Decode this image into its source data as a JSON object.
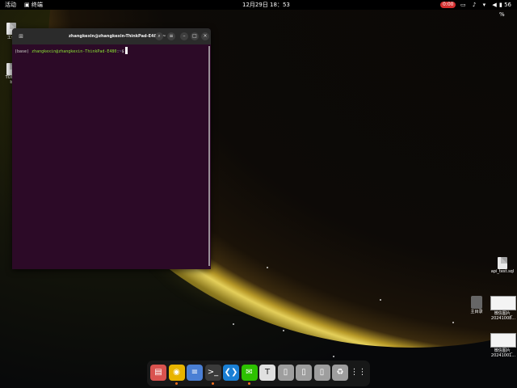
{
  "topbar": {
    "activities": "活动",
    "app_menu": "终端",
    "clock": "12月29日  18：53",
    "recording": "0:00",
    "tray_icons": [
      "display-icon",
      "sound-icon",
      "network-icon",
      "volume-icon"
    ],
    "battery": "56 %"
  },
  "desktop": {
    "left_icons": [
      {
        "name": "workspace-folder",
        "label": "工作"
      },
      {
        "name": "todo-file",
        "label": "TODO"
      },
      {
        "name": "todo-file-sub",
        "label": "b"
      }
    ],
    "right_icons": [
      {
        "name": "api-test-sql",
        "label": "api_test.sql"
      },
      {
        "name": "home-dir",
        "label": "主目录"
      },
      {
        "name": "wechat-image-1",
        "label": "微信图片_",
        "sublabel": "20241008..."
      },
      {
        "name": "wechat-image-2",
        "label": "微信图片_",
        "sublabel": "20241001..."
      }
    ]
  },
  "terminal": {
    "title": "zhangkexin@zhangkexin-ThinkPad-E480: ~",
    "prompt_env": "(base)",
    "prompt_user": "zhangkexin@zhangkexin-ThinkPad-E480",
    "prompt_path": "~",
    "prompt_symbol": "$"
  },
  "dock": {
    "items": [
      {
        "name": "files-app",
        "glyph": "▤",
        "color": "#d9534f",
        "active": false
      },
      {
        "name": "chrome-app",
        "glyph": "◉",
        "color": "#e8b400",
        "active": true
      },
      {
        "name": "text-editor-app",
        "glyph": "≡",
        "color": "#4a7fd4",
        "active": false
      },
      {
        "name": "terminal-app",
        "glyph": ">_",
        "color": "#3a3a3a",
        "active": true
      },
      {
        "name": "vscode-app",
        "glyph": "❮❯",
        "color": "#1a7fd4",
        "active": false
      },
      {
        "name": "wechat-app",
        "glyph": "✉",
        "color": "#2dc100",
        "active": true
      },
      {
        "name": "typora-app",
        "glyph": "T",
        "color": "#e0e0e0",
        "active": false
      },
      {
        "name": "drive-app-1",
        "glyph": "▯",
        "color": "#9e9e9e",
        "active": false
      },
      {
        "name": "drive-app-2",
        "glyph": "▯",
        "color": "#9e9e9e",
        "active": false
      },
      {
        "name": "drive-app-3",
        "glyph": "▯",
        "color": "#9e9e9e",
        "active": false
      },
      {
        "name": "trash-app",
        "glyph": "♻",
        "color": "#9e9e9e",
        "active": false
      },
      {
        "name": "app-grid",
        "glyph": "⋮⋮",
        "color": "#ffffff",
        "active": false
      }
    ]
  }
}
